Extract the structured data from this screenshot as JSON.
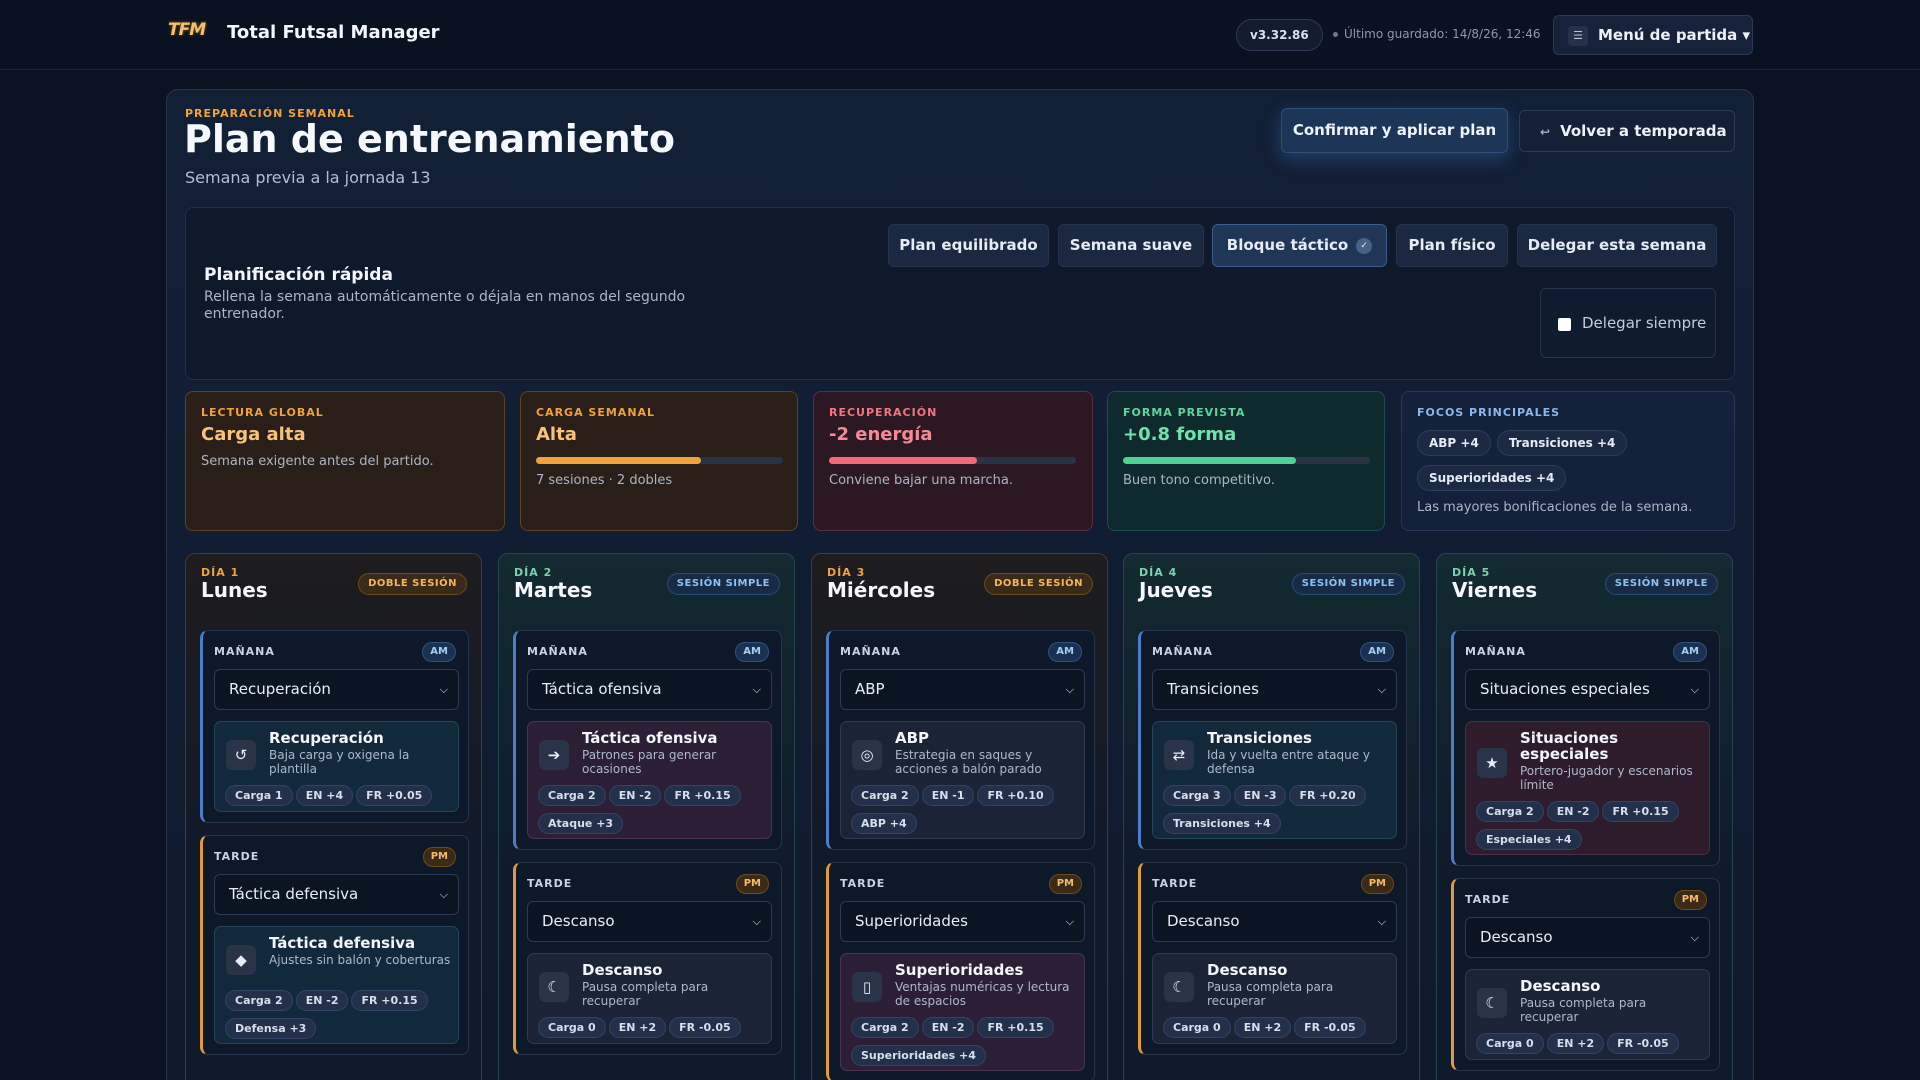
{
  "app": {
    "logo_text": "TFM",
    "title": "Total Futsal Manager",
    "version": "v3.32.86",
    "saved": "Último guardado: 14/8/26, 12:46",
    "menu_label": "Menú de partida ▾"
  },
  "header": {
    "eyebrow": "PREPARACIÓN SEMANAL",
    "title": "Plan de entrenamiento",
    "subtitle": "Semana previa a la jornada 13",
    "confirm_label": "Confirmar y aplicar plan",
    "back_label": "Volver a temporada"
  },
  "quick": {
    "title": "Planificación rápida",
    "description": "Rellena la semana automáticamente o déjala en manos del segundo entrenador.",
    "presets": [
      "Plan equilibrado",
      "Semana suave",
      "Bloque táctico",
      "Plan físico",
      "Delegar esta semana"
    ],
    "active_preset": "Bloque táctico",
    "delegate_always": "Delegar siempre"
  },
  "stats": {
    "global": {
      "label": "LECTURA GLOBAL",
      "value": "Carga alta",
      "note": "Semana exigente antes del partido."
    },
    "load": {
      "label": "CARGA SEMANAL",
      "value": "Alta",
      "note": "7 sesiones · 2 dobles",
      "progress": 0.67
    },
    "recovery": {
      "label": "RECUPERACIÓN",
      "value": "-2 energía",
      "note": "Conviene bajar una marcha.",
      "progress": 0.6
    },
    "form": {
      "label": "FORMA PREVISTA",
      "value": "+0.8 forma",
      "note": "Buen tono competitivo.",
      "progress": 0.7
    },
    "focus": {
      "label": "FOCOS PRINCIPALES",
      "chips": [
        "ABP +4",
        "Transiciones +4",
        "Superioridades +4"
      ],
      "note": "Las mayores bonificaciones de la semana."
    }
  },
  "colors": {
    "orange": "#f0a23c",
    "pink": "#f07585",
    "green": "#5fd6a0",
    "blue": "#8ab8ea"
  },
  "days": [
    {
      "num": "DÍA 1",
      "name": "Lunes",
      "badge": "DOBLE SESIÓN",
      "am": {
        "label": "MAÑANA",
        "tag": "AM",
        "select": "Recuperación",
        "drill": {
          "icon": "↺",
          "title": "Recuperación",
          "desc": "Baja carga y oxigena la plantilla",
          "pills": [
            "Carga 1",
            "EN +4",
            "FR +0.05"
          ]
        }
      },
      "pm": {
        "label": "TARDE",
        "tag": "PM",
        "select": "Táctica defensiva",
        "drill": {
          "icon": "◆",
          "title": "Táctica defensiva",
          "desc": "Ajustes sin balón y coberturas",
          "pills": [
            "Carga 2",
            "EN -2",
            "FR +0.15",
            "Defensa +3"
          ]
        }
      }
    },
    {
      "num": "DÍA 2",
      "name": "Martes",
      "badge": "SESIÓN SIMPLE",
      "am": {
        "label": "MAÑANA",
        "tag": "AM",
        "select": "Táctica ofensiva",
        "drill": {
          "icon": "➔",
          "title": "Táctica ofensiva",
          "desc": "Patrones para generar ocasiones",
          "pills": [
            "Carga 2",
            "EN -2",
            "FR +0.15",
            "Ataque +3"
          ]
        }
      },
      "pm": {
        "label": "TARDE",
        "tag": "PM",
        "select": "Descanso",
        "drill": {
          "icon": "☾",
          "title": "Descanso",
          "desc": "Pausa completa para recuperar",
          "pills": [
            "Carga 0",
            "EN +2",
            "FR -0.05"
          ]
        }
      }
    },
    {
      "num": "DÍA 3",
      "name": "Miércoles",
      "badge": "DOBLE SESIÓN",
      "am": {
        "label": "MAÑANA",
        "tag": "AM",
        "select": "ABP",
        "drill": {
          "icon": "◎",
          "title": "ABP",
          "desc": "Estrategia en saques y acciones a balón parado",
          "pills": [
            "Carga 2",
            "EN -1",
            "FR +0.10",
            "ABP +4"
          ]
        }
      },
      "pm": {
        "label": "TARDE",
        "tag": "PM",
        "select": "Superioridades",
        "drill": {
          "icon": "▯",
          "title": "Superioridades",
          "desc": "Ventajas numéricas y lectura de espacios",
          "pills": [
            "Carga 2",
            "EN -2",
            "FR +0.15",
            "Superioridades +4"
          ]
        }
      }
    },
    {
      "num": "DÍA 4",
      "name": "Jueves",
      "badge": "SESIÓN SIMPLE",
      "am": {
        "label": "MAÑANA",
        "tag": "AM",
        "select": "Transiciones",
        "drill": {
          "icon": "⇄",
          "title": "Transiciones",
          "desc": "Ida y vuelta entre ataque y defensa",
          "pills": [
            "Carga 3",
            "EN -3",
            "FR +0.20",
            "Transiciones +4"
          ]
        }
      },
      "pm": {
        "label": "TARDE",
        "tag": "PM",
        "select": "Descanso",
        "drill": {
          "icon": "☾",
          "title": "Descanso",
          "desc": "Pausa completa para recuperar",
          "pills": [
            "Carga 0",
            "EN +2",
            "FR -0.05"
          ]
        }
      }
    },
    {
      "num": "DÍA 5",
      "name": "Viernes",
      "badge": "SESIÓN SIMPLE",
      "am": {
        "label": "MAÑANA",
        "tag": "AM",
        "select": "Situaciones especiales",
        "drill": {
          "icon": "★",
          "title": "Situaciones especiales",
          "desc": "Portero-jugador y escenarios límite",
          "pills": [
            "Carga 2",
            "EN -2",
            "FR +0.15",
            "Especiales +4"
          ]
        }
      },
      "pm": {
        "label": "TARDE",
        "tag": "PM",
        "select": "Descanso",
        "drill": {
          "icon": "☾",
          "title": "Descanso",
          "desc": "Pausa completa para recuperar",
          "pills": [
            "Carga 0",
            "EN +2",
            "FR -0.05"
          ]
        }
      }
    }
  ]
}
